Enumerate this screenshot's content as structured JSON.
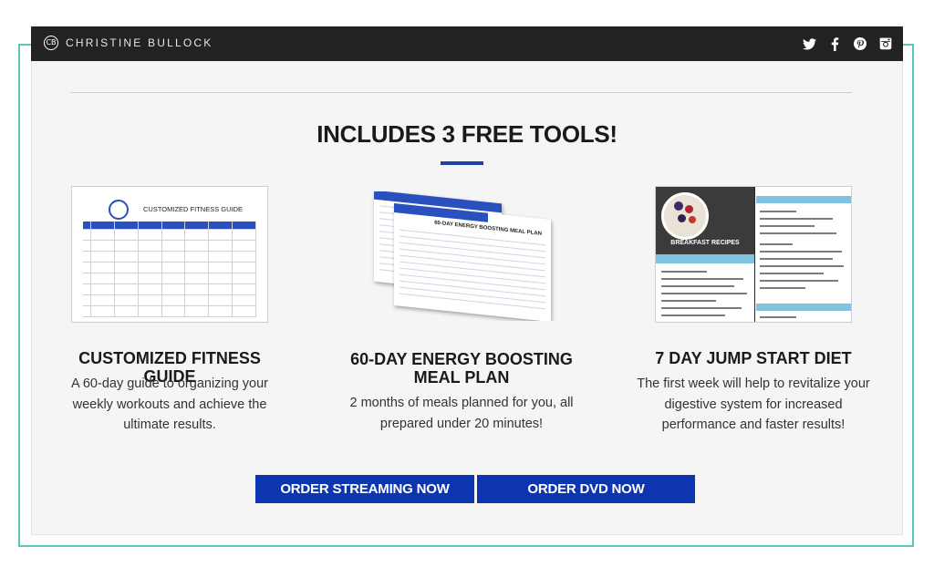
{
  "header": {
    "brand": "CHRISTINE BULLOCK",
    "logo_glyph": "CB",
    "social": [
      {
        "name": "twitter-icon",
        "glyph": "t"
      },
      {
        "name": "facebook-icon",
        "glyph": "f"
      },
      {
        "name": "pinterest-icon",
        "glyph": "p"
      },
      {
        "name": "instagram-icon",
        "glyph": "◙"
      }
    ]
  },
  "main": {
    "headline": "INCLUDES 3 FREE TOOLS!",
    "accent_color": "#1e3fa6",
    "tools": [
      {
        "title": "CUSTOMIZED FITNESS GUIDE",
        "description": "A 60-day guide to organizing your weekly workouts and achieve the ultimate results.",
        "thumbnail_title": "CUSTOMIZED FITNESS GUIDE"
      },
      {
        "title": "60-DAY ENERGY BOOSTING MEAL PLAN",
        "description": "2 months of meals planned for you, all prepared under 20 minutes!",
        "thumbnail_title": "60-DAY ENERGY BOOSTING MEAL PLAN"
      },
      {
        "title": "7 DAY JUMP START DIET",
        "description": "The first week will help to revitalize your digestive system for increased performance and faster results!",
        "thumbnail_title": "BREAKFAST RECIPES"
      }
    ],
    "buttons": {
      "streaming": "ORDER STREAMING NOW",
      "dvd": "ORDER DVD NOW"
    },
    "button_color": "#0d35b0"
  }
}
